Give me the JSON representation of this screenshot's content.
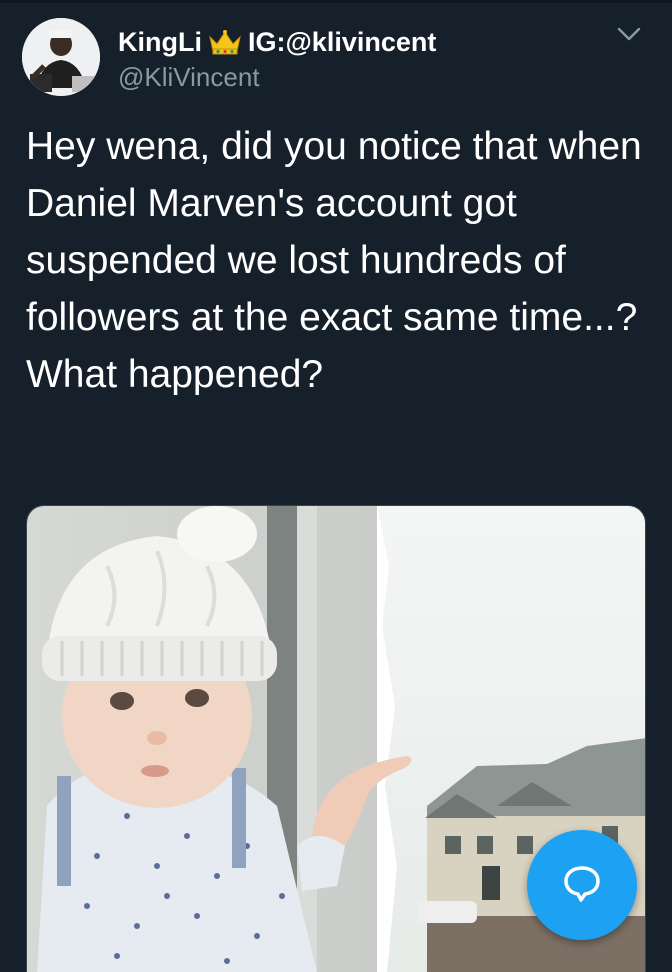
{
  "tweet": {
    "display_name": "KingLi",
    "display_name_suffix": "IG:@klivincent",
    "handle": "@KliVincent",
    "text": "Hey wena, did you notice that when Daniel Marven's account got suspended we lost hundreds of followers at the exact same time...? What happened?",
    "media": {
      "icon": "photo-baby-in-white-beanie"
    }
  },
  "icons": {
    "crown": "crown-emoji-icon",
    "menu": "chevron-down-icon",
    "compose": "compose-reply-icon"
  },
  "colors": {
    "background": "#15202b",
    "text": "#ffffff",
    "secondary": "#8899a6",
    "accent": "#1da1f2"
  }
}
